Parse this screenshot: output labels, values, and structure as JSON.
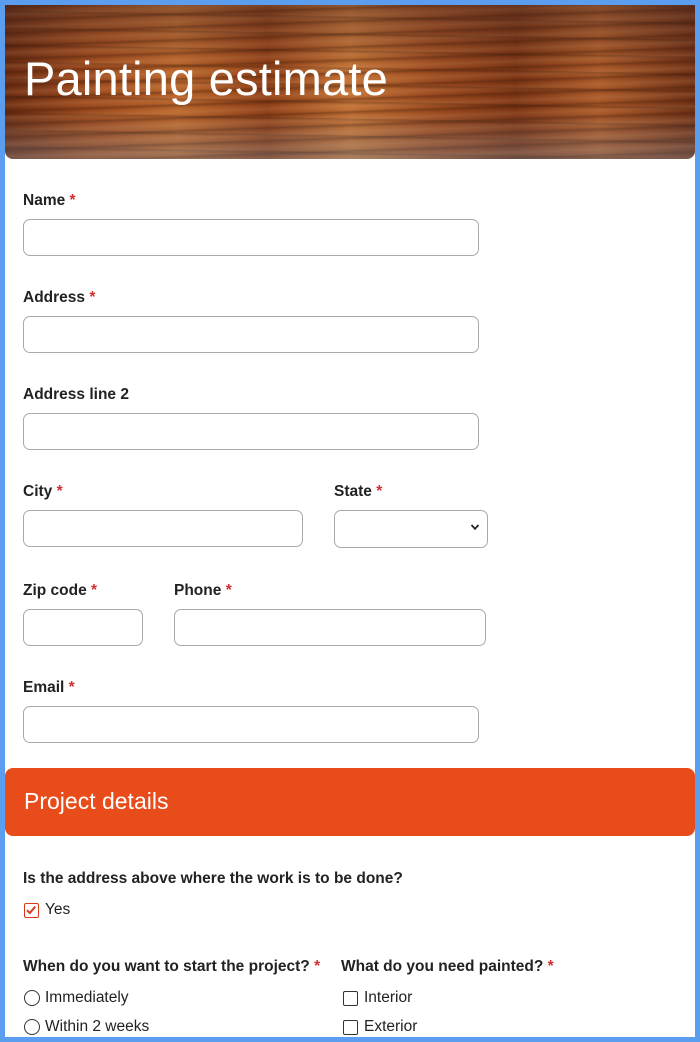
{
  "header": {
    "title": "Painting estimate"
  },
  "fields": {
    "name": {
      "label": "Name",
      "value": "",
      "required_mark": "*"
    },
    "address": {
      "label": "Address",
      "value": "",
      "required_mark": "*"
    },
    "address2": {
      "label": "Address line 2",
      "value": ""
    },
    "city": {
      "label": "City",
      "value": "",
      "required_mark": "*"
    },
    "state": {
      "label": "State",
      "value": "",
      "required_mark": "*"
    },
    "zip": {
      "label": "Zip code",
      "value": "",
      "required_mark": "*"
    },
    "phone": {
      "label": "Phone",
      "value": "",
      "required_mark": "*"
    },
    "email": {
      "label": "Email",
      "value": "",
      "required_mark": "*"
    }
  },
  "project": {
    "title": "Project details",
    "same_address": {
      "question": "Is the address above where the work is to be done?",
      "option": "Yes",
      "checked": true
    },
    "start": {
      "question": "When do you want to start the project?",
      "required_mark": "*",
      "options": [
        "Immediately",
        "Within 2 weeks"
      ]
    },
    "painted": {
      "question": "What do you need painted?",
      "required_mark": "*",
      "options": [
        "Interior",
        "Exterior"
      ]
    }
  },
  "colors": {
    "accent": "#e84c1b",
    "required": "#d32f2f",
    "background": "#5b9ef0"
  }
}
